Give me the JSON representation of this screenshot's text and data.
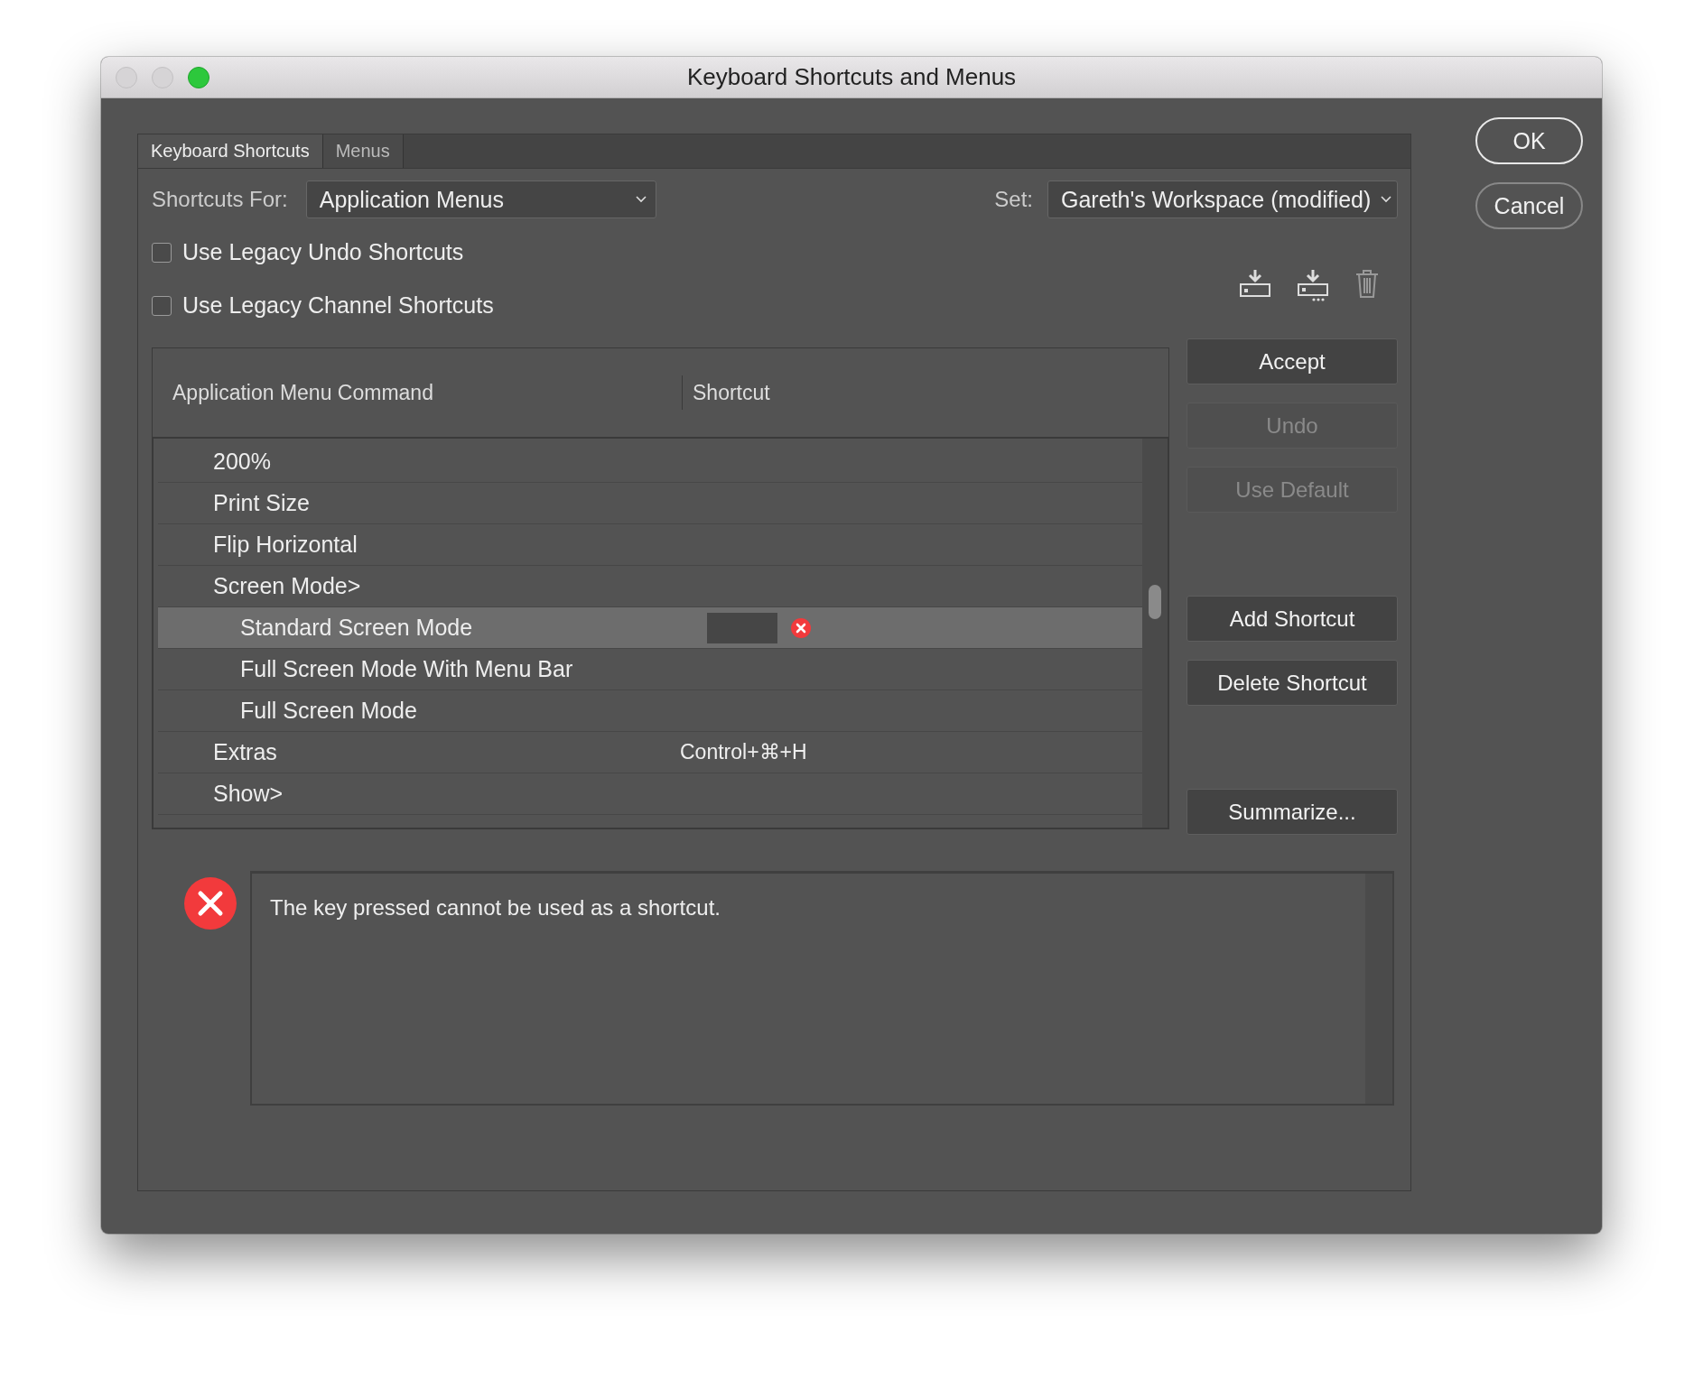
{
  "window": {
    "title": "Keyboard Shortcuts and Menus"
  },
  "tabs": [
    {
      "label": "Keyboard Shortcuts",
      "selected": true
    },
    {
      "label": "Menus",
      "selected": false
    }
  ],
  "shortcuts_for": {
    "label": "Shortcuts For:",
    "value": "Application Menus"
  },
  "set": {
    "label": "Set:",
    "value": "Gareth's Workspace (modified)"
  },
  "options": [
    {
      "label": "Use Legacy Undo Shortcuts",
      "checked": false
    },
    {
      "label": "Use Legacy Channel Shortcuts",
      "checked": false
    }
  ],
  "table": {
    "columns": [
      "Application Menu Command",
      "Shortcut"
    ],
    "rows": [
      {
        "command": "200%",
        "selected": false
      },
      {
        "command": "Print Size",
        "selected": false
      },
      {
        "command": "Flip Horizontal",
        "selected": false
      },
      {
        "command": "Screen Mode>",
        "selected": false,
        "children": [
          {
            "command": "Standard Screen Mode",
            "selected": true,
            "error": true
          },
          {
            "command": "Full Screen Mode With Menu Bar",
            "selected": false
          },
          {
            "command": "Full Screen Mode",
            "selected": false
          }
        ]
      },
      {
        "command": "Extras",
        "shortcut": "Control+⌘+H",
        "selected": false
      },
      {
        "command": "Show>",
        "selected": false
      }
    ]
  },
  "button_groups": [
    {
      "buttons": [
        {
          "label": "Accept",
          "disabled": false
        },
        {
          "label": "Undo",
          "disabled": true
        },
        {
          "label": "Use Default",
          "disabled": true
        }
      ]
    },
    {
      "buttons": [
        {
          "label": "Add Shortcut",
          "disabled": false
        },
        {
          "label": "Delete Shortcut",
          "disabled": false
        }
      ]
    },
    {
      "buttons": [
        {
          "label": "Summarize...",
          "disabled": false
        }
      ]
    }
  ],
  "message": {
    "kind": "error",
    "text": "The key pressed cannot be used as a shortcut."
  },
  "dialog_buttons": [
    {
      "label": "OK",
      "default": true
    },
    {
      "label": "Cancel",
      "default": false
    }
  ]
}
